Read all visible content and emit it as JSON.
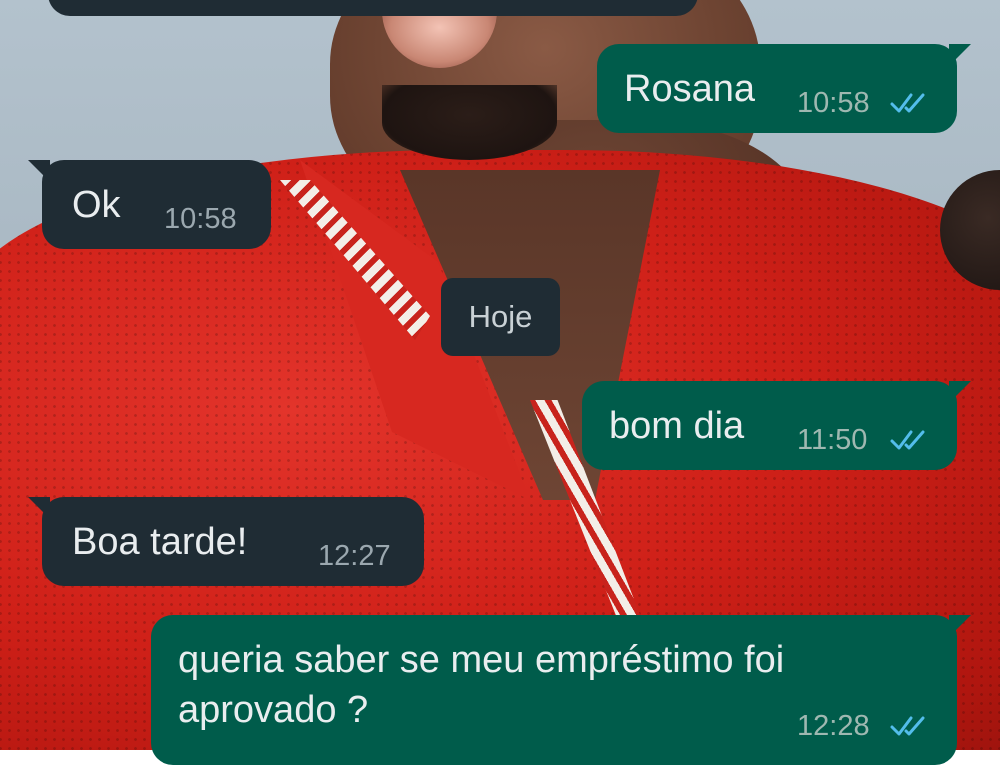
{
  "chat": {
    "messages": [
      {
        "id": "m1",
        "direction": "outgoing",
        "text": "Rosana",
        "time": "10:58",
        "status": "read"
      },
      {
        "id": "m2",
        "direction": "incoming",
        "text": "Ok",
        "time": "10:58"
      },
      {
        "id": "m3",
        "direction": "outgoing",
        "text": "bom dia",
        "time": "11:50",
        "status": "read"
      },
      {
        "id": "m4",
        "direction": "incoming",
        "text": "Boa tarde!",
        "time": "12:27"
      },
      {
        "id": "m5",
        "direction": "outgoing",
        "lines": [
          "queria saber se meu empréstimo foi",
          "aprovado ?"
        ],
        "time": "12:28",
        "status": "read"
      }
    ],
    "date_separator": "Hoje"
  },
  "icons": {
    "read_receipt": "double-check-icon"
  },
  "colors": {
    "outgoing_bubble": "#005c4b",
    "incoming_bubble": "#1f2c34",
    "message_text": "#e9edef",
    "read_tick": "#53bdeb"
  }
}
